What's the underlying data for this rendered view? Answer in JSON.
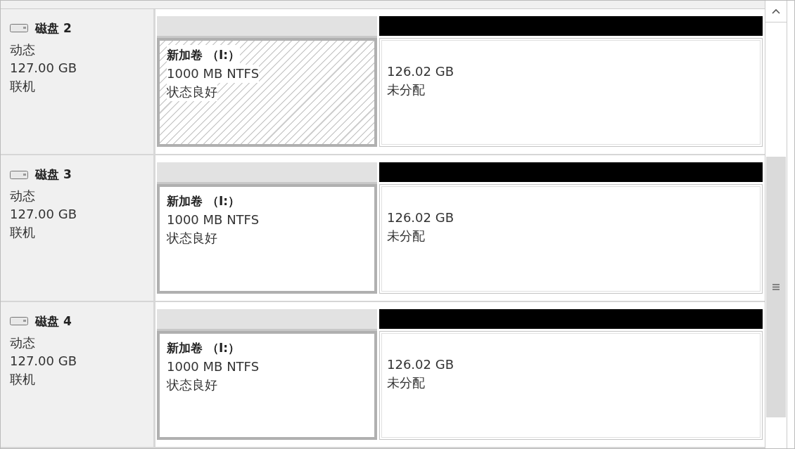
{
  "disks": [
    {
      "name": "磁盘 2",
      "type": "动态",
      "size": "127.00 GB",
      "status": "联机",
      "partitions": [
        {
          "kind": "volume",
          "selected": true,
          "name": "新加卷 （I:）",
          "size": "1000 MB NTFS",
          "status": "状态良好"
        },
        {
          "kind": "unallocated",
          "selected": false,
          "size": "126.02 GB",
          "status": "未分配"
        }
      ]
    },
    {
      "name": "磁盘 3",
      "type": "动态",
      "size": "127.00 GB",
      "status": "联机",
      "partitions": [
        {
          "kind": "volume",
          "selected": false,
          "name": "新加卷 （I:）",
          "size": "1000 MB NTFS",
          "status": "状态良好"
        },
        {
          "kind": "unallocated",
          "selected": false,
          "size": "126.02 GB",
          "status": "未分配"
        }
      ]
    },
    {
      "name": "磁盘 4",
      "type": "动态",
      "size": "127.00 GB",
      "status": "联机",
      "partitions": [
        {
          "kind": "volume",
          "selected": false,
          "name": "新加卷 （I:）",
          "size": "1000 MB NTFS",
          "status": "状态良好"
        },
        {
          "kind": "unallocated",
          "selected": false,
          "size": "126.02 GB",
          "status": "未分配"
        }
      ]
    }
  ]
}
